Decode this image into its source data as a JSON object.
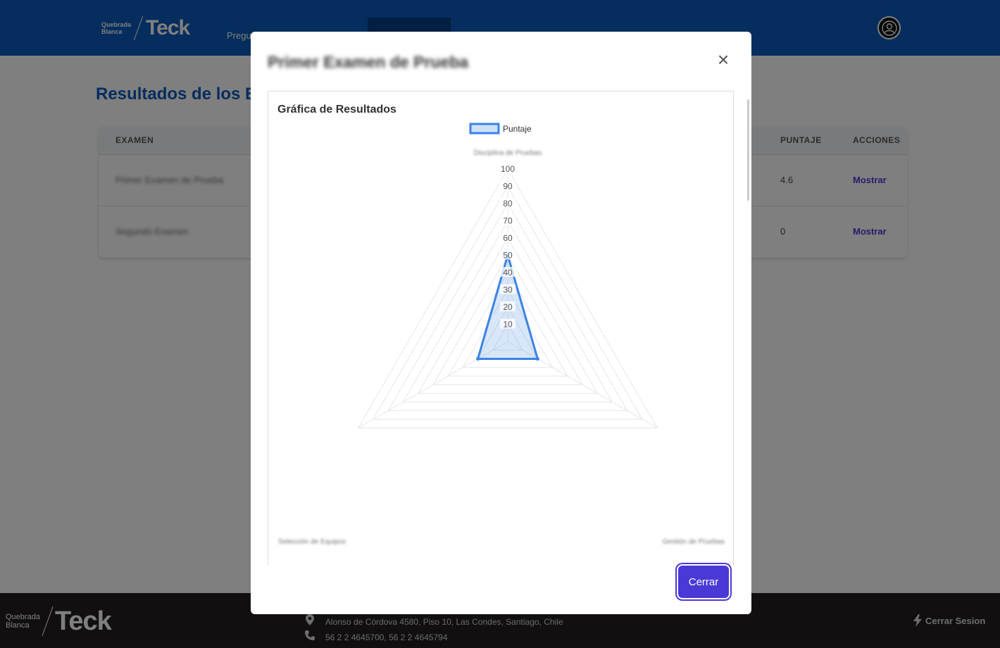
{
  "header": {
    "brand_small_line1": "Quebrada",
    "brand_small_line2": "Blanca",
    "brand_big": "Teck",
    "nav_item": "Pregu"
  },
  "page": {
    "title": "Resultados de los E",
    "table": {
      "headers": [
        "EXAMEN",
        "PUNTAJE",
        "ACCIONES"
      ],
      "rows": [
        {
          "exam": "Primer Examen de Prueba",
          "score": "4.6",
          "action": "Mostrar"
        },
        {
          "exam": "Segundo Examen",
          "score": "0",
          "action": "Mostrar"
        }
      ]
    }
  },
  "footer": {
    "brand_small_line1": "Quebrada",
    "brand_small_line2": "Blanca",
    "brand_big": "Teck",
    "address": "Alonso de Córdova 4580, Piso 10, Las Condes, Santiago, Chile",
    "phone": "56 2 2 4645700, 56 2 2 4645794",
    "logout": "Cerrar Sesion"
  },
  "modal": {
    "title": "Primer Examen de Prueba",
    "chart_heading": "Gráfica de Resultados",
    "close_button": "Cerrar"
  },
  "colors": {
    "header_blue": "#0a5bbd",
    "title_blue": "#0a5bbd",
    "link_purple": "#4b39d6",
    "series_line": "#3b82e6",
    "series_fill": "rgba(59,130,230,0.2)",
    "footer_bg": "#231f20"
  },
  "chart_data": {
    "type": "radar",
    "title": "Gráfica de Resultados",
    "legend_position": "top",
    "categories": [
      "Disciplina de Pruebas",
      "Gestión de Pruebas",
      "Selección de Equipos"
    ],
    "series": [
      {
        "name": "Puntaje",
        "values": [
          50,
          20,
          20
        ]
      }
    ],
    "rlim": [
      0,
      100
    ],
    "ticks": [
      10,
      20,
      30,
      40,
      50,
      60,
      70,
      80,
      90,
      100
    ],
    "grid": true
  }
}
